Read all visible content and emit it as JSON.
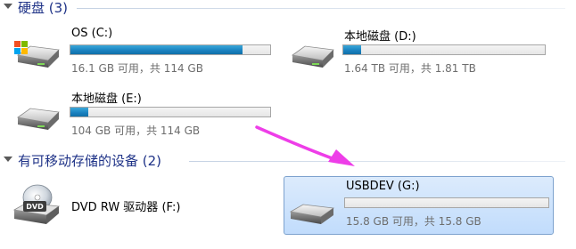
{
  "hard_disks": {
    "title": "硬盘 (3)",
    "drives": [
      {
        "name": "OS (C:)",
        "info": "16.1 GB 可用，共 114 GB",
        "used_fraction": 0.86,
        "icon": "hard-drive-os-icon"
      },
      {
        "name": "本地磁盘 (D:)",
        "info": "1.64 TB 可用，共 1.81 TB",
        "used_fraction": 0.09,
        "icon": "hard-drive-icon"
      },
      {
        "name": "本地磁盘 (E:)",
        "info": "104 GB 可用，共 114 GB",
        "used_fraction": 0.09,
        "icon": "hard-drive-icon"
      }
    ]
  },
  "removable": {
    "title": "有可移动存储的设备 (2)",
    "devices": [
      {
        "name": "DVD RW 驱动器 (F:)",
        "icon": "dvd-drive-icon"
      },
      {
        "name": "USBDEV (G:)",
        "info": "15.8 GB 可用，共 15.8 GB",
        "used_fraction": 0.0,
        "icon": "usb-drive-icon",
        "selected": true
      }
    ]
  },
  "colors": {
    "section_title": "#1e3287",
    "bar_fill": "#1b83c1",
    "selection_bg": "#c1dcfc",
    "annotation_arrow": "#ee3ee8"
  }
}
